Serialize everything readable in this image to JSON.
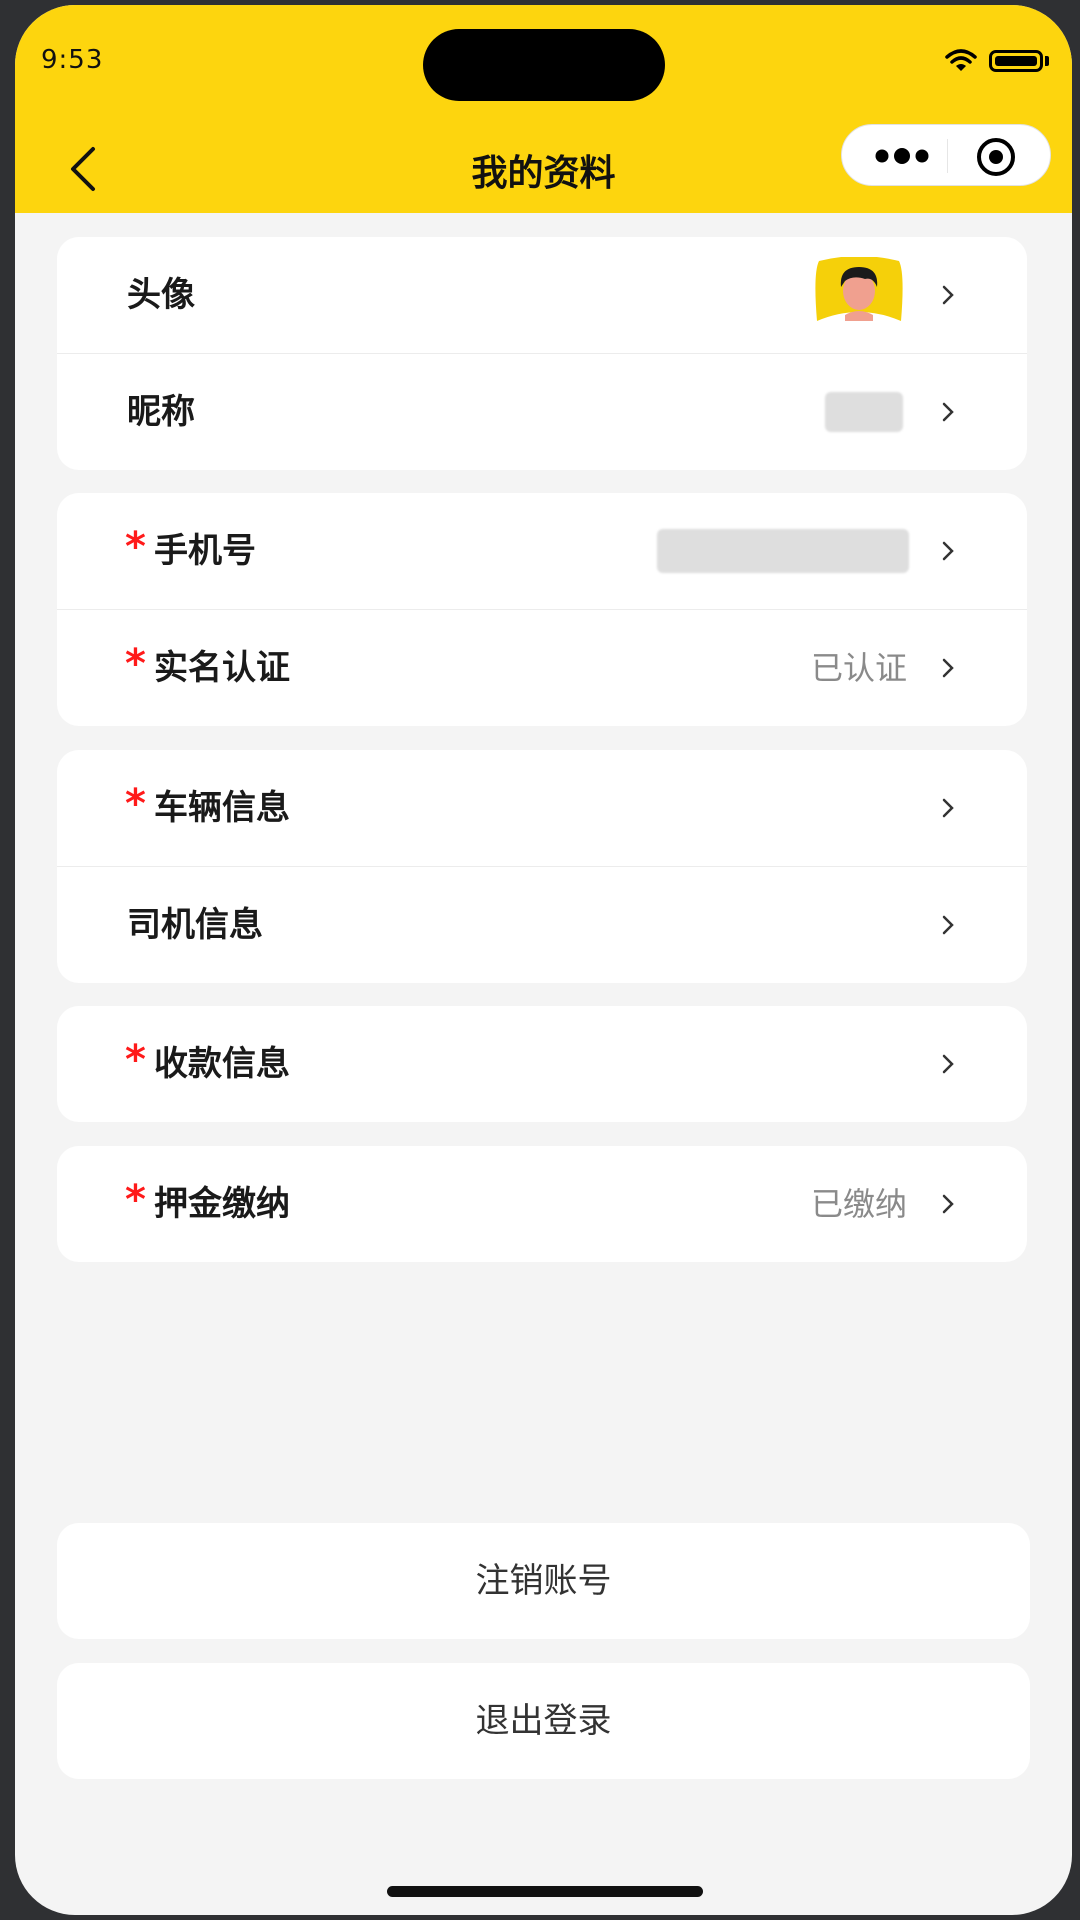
{
  "status_bar": {
    "time": "9:53",
    "icons": [
      "wifi-icon",
      "battery-icon"
    ]
  },
  "nav": {
    "title": "我的资料",
    "back_icon": "chevron-left-icon",
    "capsule_icons": [
      "more-dots-icon",
      "target-icon"
    ]
  },
  "profile": {
    "avatar_label": "头像",
    "nickname_label": "昵称"
  },
  "account": {
    "phone_label": "手机号",
    "realname_label": "实名认证",
    "realname_value": "已认证"
  },
  "vehicle": {
    "vehicle_label": "车辆信息",
    "driver_label": "司机信息"
  },
  "payment": {
    "payment_label": "收款信息"
  },
  "deposit": {
    "deposit_label": "押金缴纳",
    "deposit_value": "已缴纳"
  },
  "required_mark": "*",
  "actions": {
    "cancel_account": "注销账号",
    "logout": "退出登录"
  },
  "colors": {
    "header": "#fdd50e",
    "required": "#ff1a1a",
    "page_bg": "#f4f4f4"
  }
}
